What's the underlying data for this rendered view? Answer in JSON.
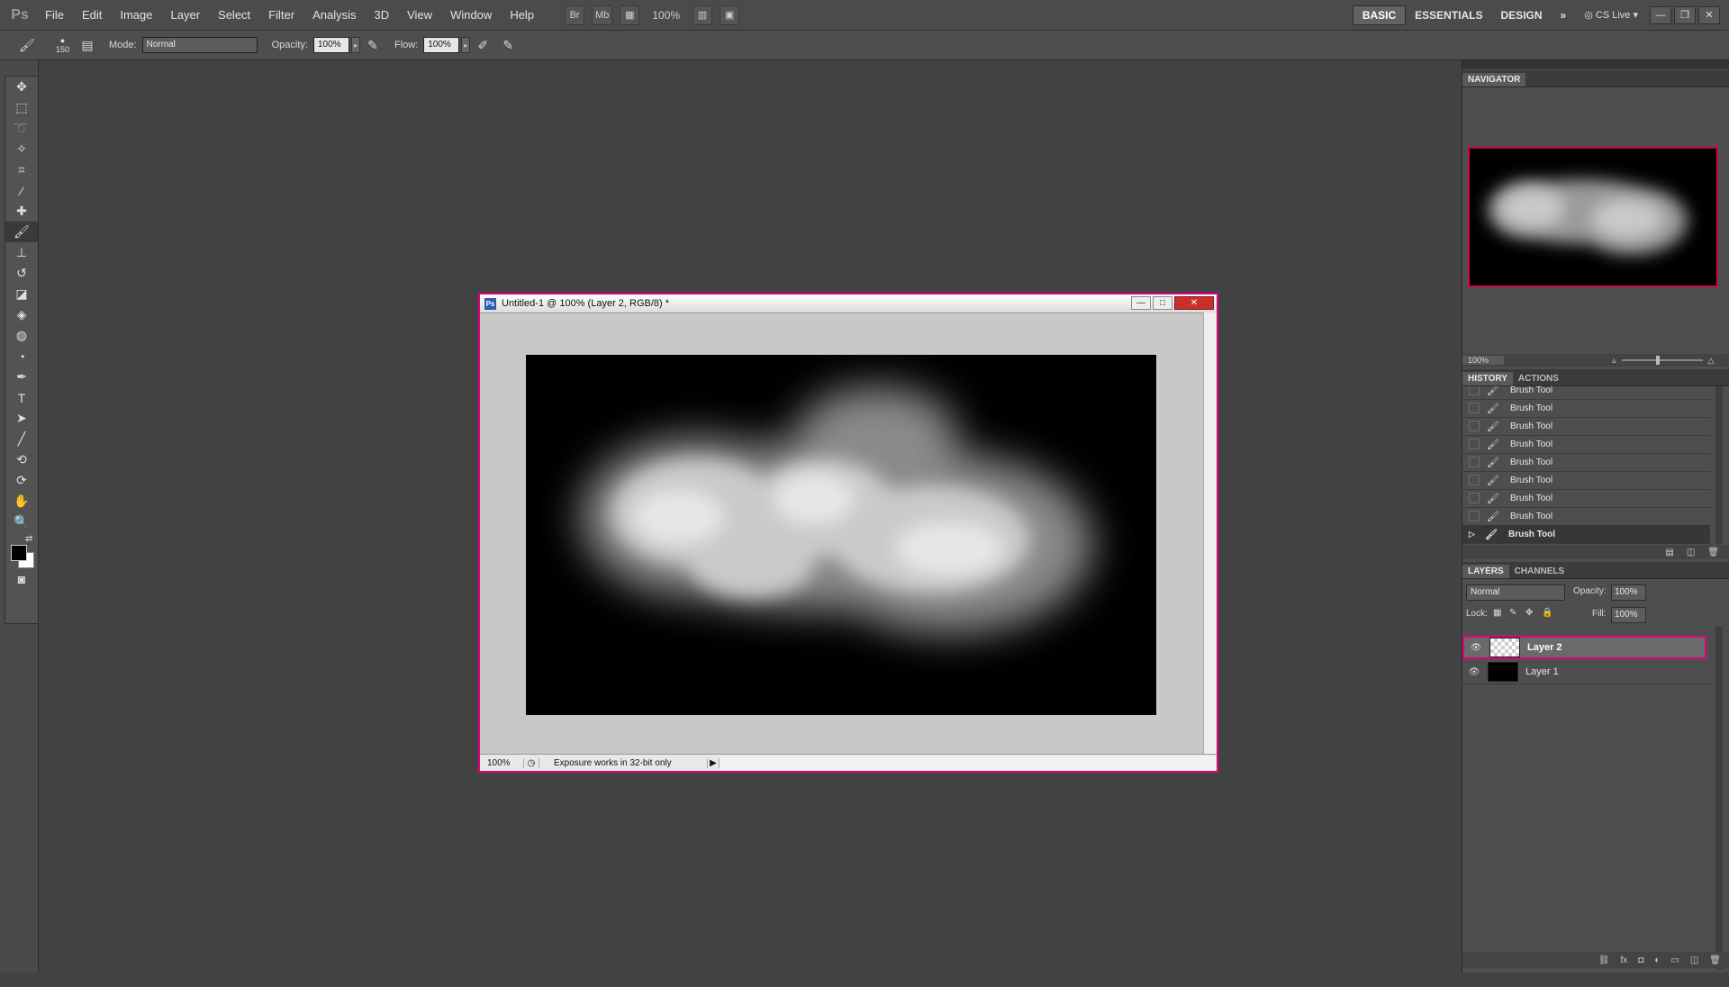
{
  "app": {
    "logo": "Ps",
    "menu": [
      "File",
      "Edit",
      "Image",
      "Layer",
      "Select",
      "Filter",
      "Analysis",
      "3D",
      "View",
      "Window",
      "Help"
    ],
    "toolbar_buttons": [
      "Br",
      "Mb"
    ],
    "zoom_display": "100%",
    "workspaces": [
      "BASIC",
      "ESSENTIALS",
      "DESIGN"
    ],
    "cs_live": "CS Live"
  },
  "options_bar": {
    "brush_size": "150",
    "mode_label": "Mode:",
    "mode_value": "Normal",
    "opacity_label": "Opacity:",
    "opacity_value": "100%",
    "flow_label": "Flow:",
    "flow_value": "100%"
  },
  "document": {
    "title": "Untitled-1 @ 100% (Layer 2, RGB/8) *",
    "status_zoom": "100%",
    "status_text": "Exposure works in 32-bit only"
  },
  "navigator": {
    "tab": "NAVIGATOR",
    "zoom": "100%"
  },
  "history": {
    "tabs": [
      "HISTORY",
      "ACTIONS"
    ],
    "items": [
      "Brush Tool",
      "Brush Tool",
      "Brush Tool",
      "Brush Tool",
      "Brush Tool",
      "Brush Tool",
      "Brush Tool",
      "Brush Tool",
      "Brush Tool"
    ]
  },
  "layers": {
    "tabs": [
      "LAYERS",
      "CHANNELS"
    ],
    "blend_mode": "Normal",
    "opacity_label": "Opacity:",
    "opacity_value": "100%",
    "lock_label": "Lock:",
    "fill_label": "Fill:",
    "fill_value": "100%",
    "items": [
      {
        "name": "Layer 2",
        "selected": true
      },
      {
        "name": "Layer 1",
        "selected": false
      }
    ]
  },
  "colors": {
    "accent_highlight": "#e0007f",
    "foreground": "#000000",
    "background": "#ffffff"
  }
}
